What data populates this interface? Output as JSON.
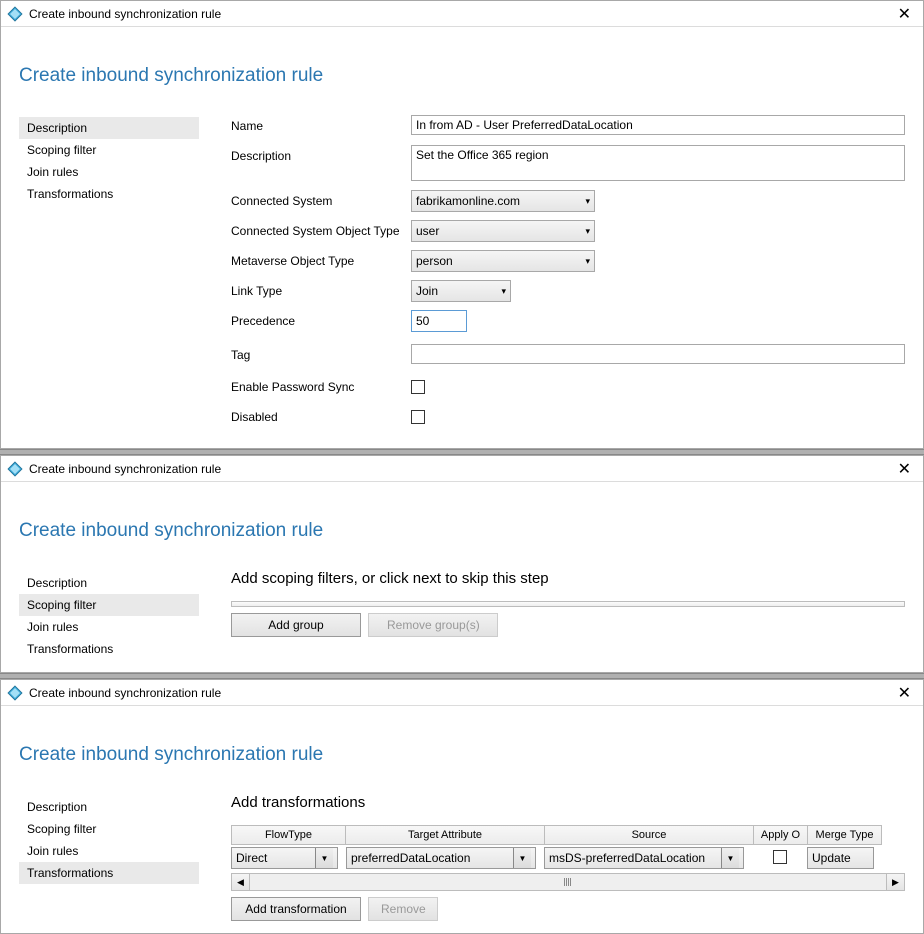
{
  "titlebar": {
    "title": "Create inbound synchronization rule",
    "close": "✕"
  },
  "heading": "Create inbound synchronization rule",
  "nav": {
    "description": "Description",
    "scoping": "Scoping filter",
    "join": "Join rules",
    "transformations": "Transformations"
  },
  "desc": {
    "labels": {
      "name": "Name",
      "description": "Description",
      "connectedSystem": "Connected System",
      "csot": "Connected System Object Type",
      "mot": "Metaverse Object Type",
      "linkType": "Link Type",
      "precedence": "Precedence",
      "tag": "Tag",
      "enablePwd": "Enable Password Sync",
      "disabled": "Disabled"
    },
    "values": {
      "name": "In from AD - User PreferredDataLocation",
      "description": "Set the Office 365 region",
      "connectedSystem": "fabrikamonline.com",
      "csot": "user",
      "mot": "person",
      "linkType": "Join",
      "precedence": "50"
    }
  },
  "scoping": {
    "subheading": "Add scoping filters, or click next to skip this step",
    "addGroup": "Add group",
    "removeGroup": "Remove group(s)"
  },
  "trans": {
    "subheading": "Add transformations",
    "cols": {
      "flowType": "FlowType",
      "target": "Target Attribute",
      "source": "Source",
      "apply": "Apply O",
      "merge": "Merge Type"
    },
    "row": {
      "flowType": "Direct",
      "target": "preferredDataLocation",
      "source": "msDS-preferredDataLocation",
      "merge": "Update"
    },
    "addBtn": "Add transformation",
    "removeBtn": "Remove"
  }
}
